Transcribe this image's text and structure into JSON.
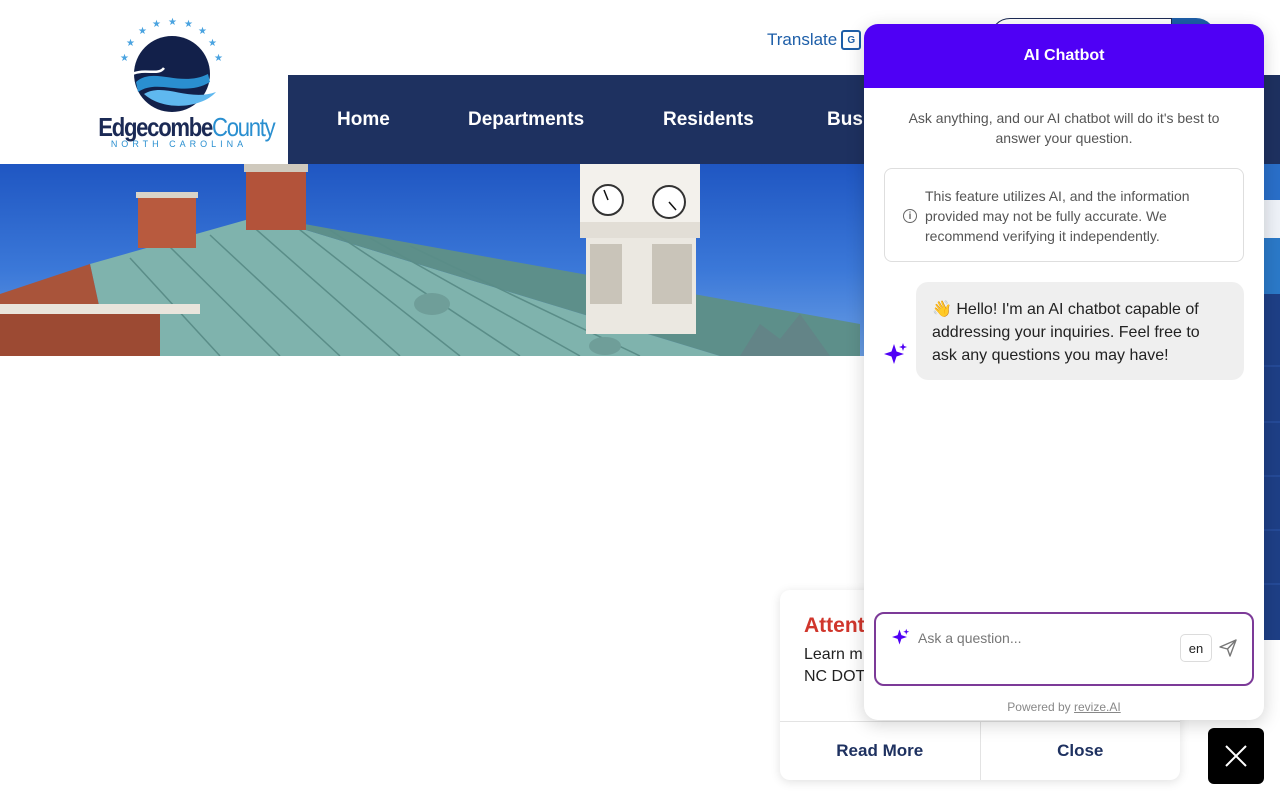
{
  "header": {
    "logo": {
      "name_part1": "Edgecombe",
      "name_part2": "County",
      "subtitle": "NORTH CAROLINA"
    },
    "translate_label": "Translate",
    "translate_icon": "translate-icon",
    "search_icon": "search-icon"
  },
  "nav": {
    "items": [
      {
        "label": "Home"
      },
      {
        "label": "Departments"
      },
      {
        "label": "Residents"
      },
      {
        "label": "Busi"
      }
    ]
  },
  "alert": {
    "title": "Attent",
    "body_line1": "Learn m",
    "body_line2": "NC DOT",
    "read_more_label": "Read More",
    "close_label": "Close",
    "title_color": "#d0362c"
  },
  "chatbot": {
    "title": "AI Chatbot",
    "header_color": "#4f00f5",
    "intro": "Ask anything, and our AI chatbot will do it's best to answer your question.",
    "disclaimer": "This feature utilizes AI, and the information provided may not be fully accurate. We recommend verifying it independently.",
    "greeting": "👋 Hello! I'm an AI chatbot capable of addressing your inquiries. Feel free to ask any questions you may have!",
    "input_placeholder": "Ask a question...",
    "input_value": "",
    "language": "en",
    "powered_prefix": "Powered by",
    "powered_link": "revize.AI"
  },
  "colors": {
    "nav_bg": "#1e3160",
    "accent_blue": "#1d5ea8",
    "composer_border": "#7c3a98"
  }
}
